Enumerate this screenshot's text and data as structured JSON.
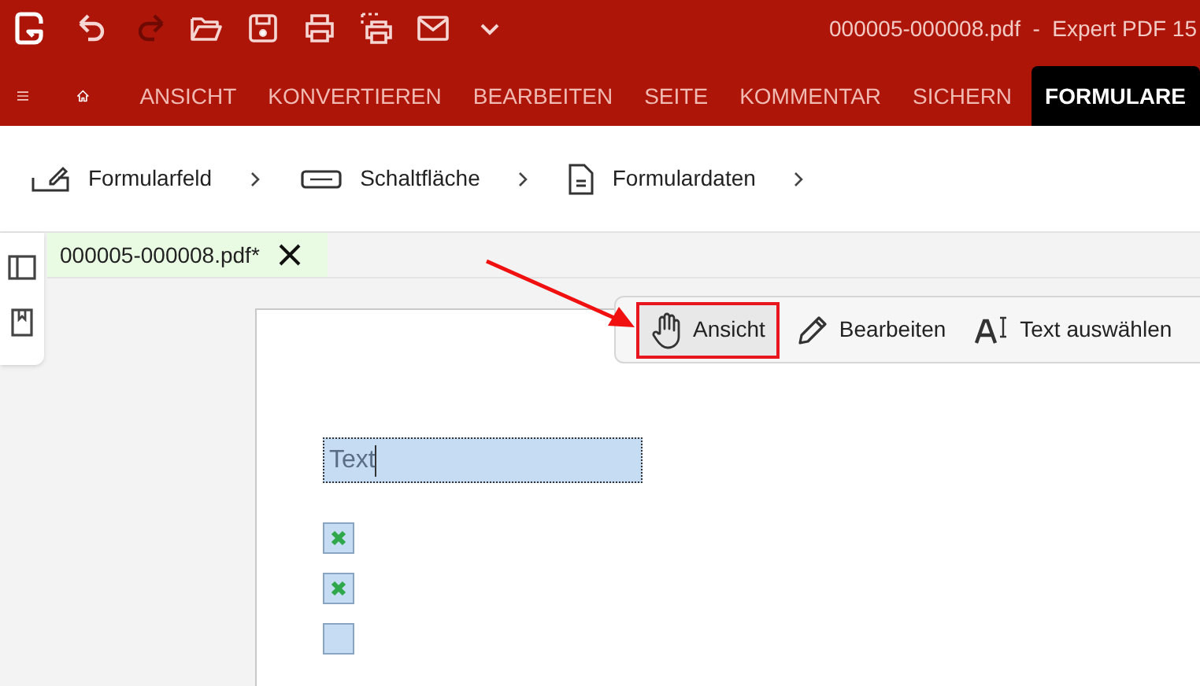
{
  "quick_tools": [
    {
      "kind": "undo",
      "disabled": false
    },
    {
      "kind": "redo",
      "disabled": true
    },
    {
      "kind": "open",
      "disabled": false
    },
    {
      "kind": "save",
      "disabled": false
    },
    {
      "kind": "print",
      "disabled": false
    },
    {
      "kind": "print-area",
      "disabled": false
    },
    {
      "kind": "mail",
      "disabled": false
    },
    {
      "kind": "more",
      "disabled": false
    }
  ],
  "window": {
    "title": "000005-000008.pdf  -  Expert PDF 15"
  },
  "menu_tabs": [
    {
      "label": "ANSICHT",
      "selected": false
    },
    {
      "label": "KONVERTIEREN",
      "selected": false
    },
    {
      "label": "BEARBEITEN",
      "selected": false
    },
    {
      "label": "SEITE",
      "selected": false
    },
    {
      "label": "KOMMENTAR",
      "selected": false
    },
    {
      "label": "SICHERN",
      "selected": false
    },
    {
      "label": "FORMULARE",
      "selected": true
    }
  ],
  "ribbon": [
    {
      "label": "Formularfeld",
      "kind": "field"
    },
    {
      "label": "Schaltfläche",
      "kind": "button"
    },
    {
      "label": "Formulardaten",
      "kind": "data"
    }
  ],
  "document_tab": {
    "label": "000005-000008.pdf*"
  },
  "tool_bar": [
    {
      "label": "Ansicht",
      "kind": "hand",
      "selected": true
    },
    {
      "label": "Bearbeiten",
      "kind": "pencil",
      "selected": false
    },
    {
      "label": "Text auswählen",
      "kind": "text",
      "selected": false
    }
  ],
  "form": {
    "text_field": {
      "value": "Text"
    },
    "checkboxes": [
      {
        "checked": true
      },
      {
        "checked": true
      },
      {
        "checked": false
      }
    ]
  }
}
